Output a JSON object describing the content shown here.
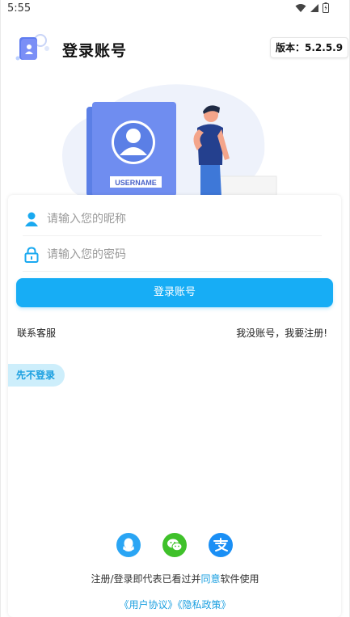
{
  "status_bar": {
    "time": "5:55"
  },
  "header": {
    "title": "登录账号",
    "version": "版本：5.2.5.9"
  },
  "hero": {
    "card_label": "USERNAME"
  },
  "form": {
    "nickname_placeholder": "请输入您的昵称",
    "password_placeholder": "请输入您的密码",
    "login_button": "登录账号"
  },
  "links": {
    "contact": "联系客服",
    "register": "我没账号，我要注册!"
  },
  "skip_button": "先不登录",
  "social": [
    "qq-icon",
    "wechat-icon",
    "alipay-icon"
  ],
  "agreement": {
    "prefix": "注册/登录即代表已看过并",
    "highlight": "同意",
    "suffix": "软件使用",
    "user_agreement": "《用户协议》",
    "privacy_policy": "《隐私政策》"
  },
  "colors": {
    "accent": "#17adf5",
    "skip_bg": "#cdeefb",
    "qq": "#2aa5f4",
    "wechat": "#3fc12a",
    "alipay": "#1a8ff5"
  }
}
